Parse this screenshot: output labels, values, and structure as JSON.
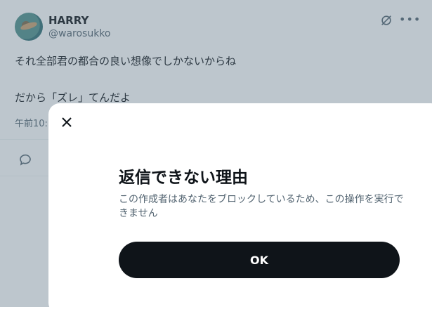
{
  "tweet": {
    "author_name": "HARRY",
    "author_handle": "@warosukko",
    "lines": [
      "それ全部君の都合の良い想像でしかないからね",
      "だから「ズレ」てんだよ"
    ],
    "timestamp": "午前10:"
  },
  "dialog": {
    "title": "返信できない理由",
    "description": "この作成者はあなたをブロックしているため、この操作を実行できません",
    "ok_label": "OK"
  },
  "colors": {
    "text_primary": "#0f1419",
    "text_secondary": "#536471",
    "button_bg": "#0f1419",
    "overlay": "rgba(91,112,131,0.40)"
  },
  "icons": {
    "close": "close-icon",
    "grok": "grok-icon",
    "more": "more-icon",
    "reply": "reply-icon"
  }
}
